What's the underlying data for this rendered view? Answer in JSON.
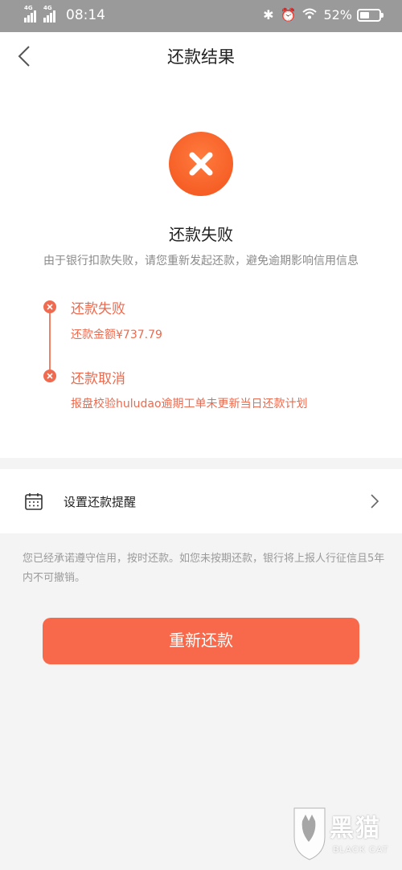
{
  "status_bar": {
    "network_1": "4G",
    "network_2": "4G",
    "time": "08:14",
    "battery_text": "52%",
    "battery_level": 0.52
  },
  "nav": {
    "title": "还款结果"
  },
  "result": {
    "title": "还款失败",
    "description": "由于银行扣款失败，请您重新发起还款，避免逾期影响信用信息"
  },
  "timeline": [
    {
      "title": "还款失败",
      "detail": "还款金额¥737.79"
    },
    {
      "title": "还款取消",
      "detail": "报盘校验huludao逾期工单未更新当日还款计划"
    }
  ],
  "reminder": {
    "label": "设置还款提醒"
  },
  "notice": "您已经承诺遵守信用，按时还款。如您未按期还款，银行将上报人行征信且5年内不可撤销。",
  "retry_button": "重新还款",
  "watermark": {
    "text": "黑猫",
    "sub": "BLACK CAT"
  },
  "colors": {
    "accent": "#f8694b",
    "timeline": "#ec6a4e",
    "status_bar": "#9a9a9a"
  }
}
